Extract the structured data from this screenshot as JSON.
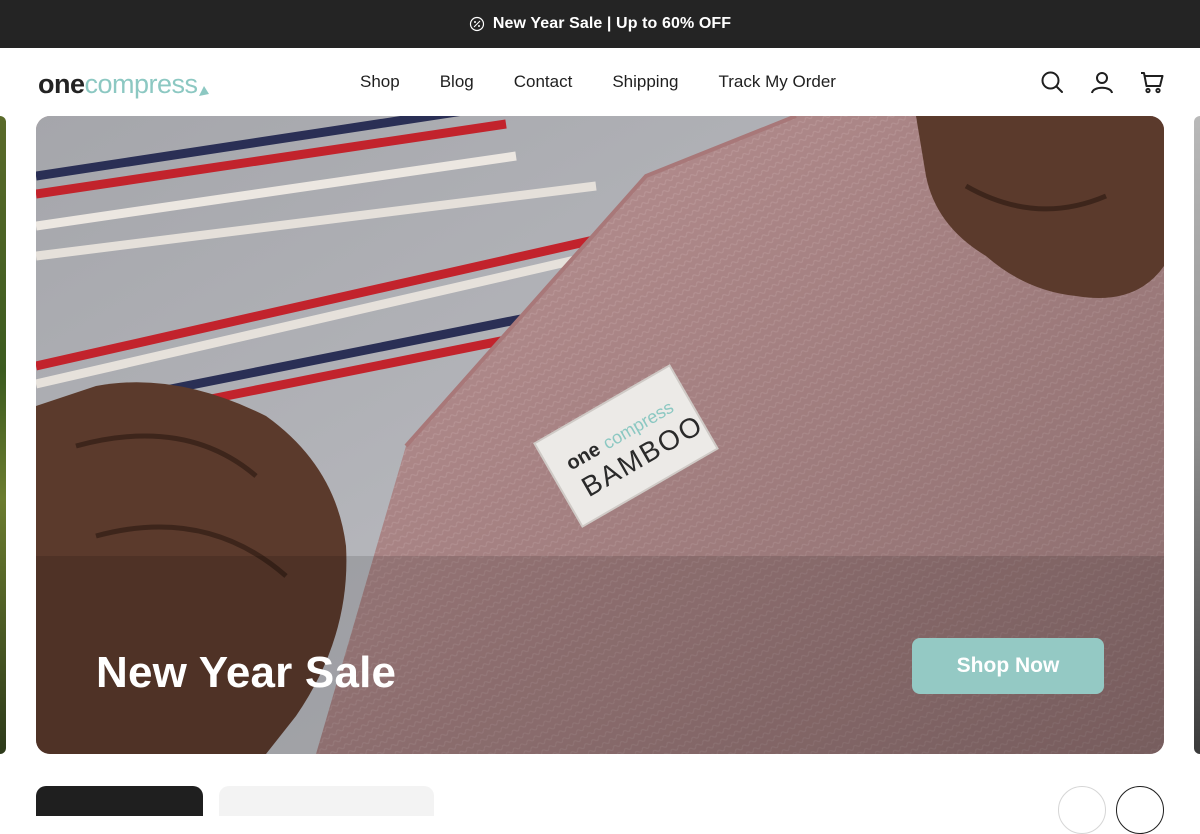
{
  "announcement": {
    "text": "New Year Sale | Up to 60% OFF",
    "icon": "discount-badge-icon"
  },
  "brand": {
    "one": "one",
    "compress": "compress",
    "accent": "#8cc8c2"
  },
  "nav": {
    "items": [
      {
        "label": "Shop"
      },
      {
        "label": "Blog"
      },
      {
        "label": "Contact"
      },
      {
        "label": "Shipping"
      },
      {
        "label": "Track My Order"
      }
    ]
  },
  "header_icons": [
    "search-icon",
    "account-icon",
    "cart-icon"
  ],
  "hero": {
    "title": "New Year Sale",
    "button_label": "Shop Now",
    "button_color": "#94c9c4",
    "label_brand_one": "one",
    "label_brand_compress": "compress",
    "label_text": "BAMBOO"
  }
}
